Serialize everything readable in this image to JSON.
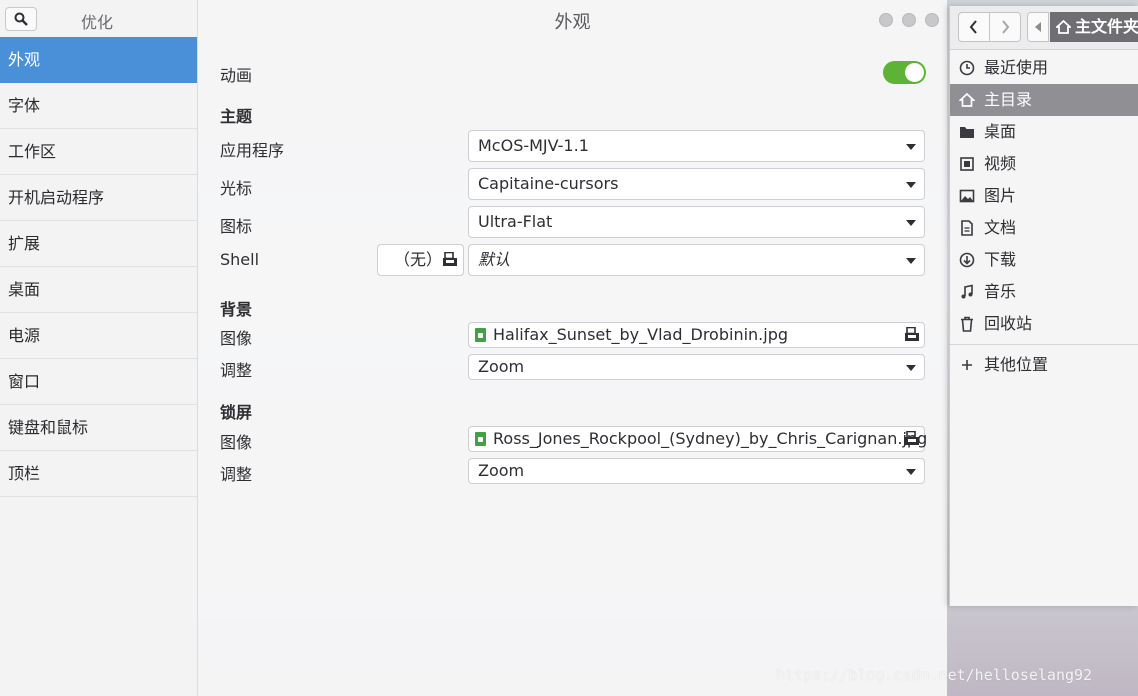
{
  "tweaks": {
    "sidebar": {
      "title": "优化",
      "items": [
        {
          "label": "外观",
          "active": true
        },
        {
          "label": "字体"
        },
        {
          "label": "工作区"
        },
        {
          "label": "开机启动程序"
        },
        {
          "label": "扩展"
        },
        {
          "label": "桌面"
        },
        {
          "label": "电源"
        },
        {
          "label": "窗口"
        },
        {
          "label": "键盘和鼠标"
        },
        {
          "label": "顶栏"
        }
      ]
    },
    "title": "外观",
    "animation": {
      "label": "动画",
      "enabled": true
    },
    "theme": {
      "heading": "主题",
      "app_label": "应用程序",
      "app_value": "McOS-MJV-1.1",
      "cursor_label": "光标",
      "cursor_value": "Capitaine-cursors",
      "icon_label": "图标",
      "icon_value": "Ultra-Flat",
      "shell_label": "Shell",
      "shell_none": "（无）",
      "shell_value": "默认"
    },
    "background": {
      "heading": "背景",
      "image_label": "图像",
      "image_value": "Halifax_Sunset_by_Vlad_Drobinin.jpg",
      "adjust_label": "调整",
      "adjust_value": "Zoom"
    },
    "lockscreen": {
      "heading": "锁屏",
      "image_label": "图像",
      "image_value": "Ross_Jones_Rockpool_(Sydney)_by_Chris_Carignan.jpg",
      "adjust_label": "调整",
      "adjust_value": "Zoom"
    }
  },
  "files": {
    "path_home": "主文件夹",
    "places": [
      {
        "label": "最近使用",
        "icon": "clock-icon"
      },
      {
        "label": "主目录",
        "icon": "home-icon",
        "active": true
      },
      {
        "label": "桌面",
        "icon": "folder-icon"
      },
      {
        "label": "视频",
        "icon": "film-icon"
      },
      {
        "label": "图片",
        "icon": "image-icon"
      },
      {
        "label": "文档",
        "icon": "document-icon"
      },
      {
        "label": "下载",
        "icon": "download-icon"
      },
      {
        "label": "音乐",
        "icon": "music-icon"
      },
      {
        "label": "回收站",
        "icon": "trash-icon"
      }
    ],
    "other_locations": "其他位置"
  },
  "watermark": "https://blog.csdn.net/helloselang92",
  "colors": {
    "accent": "#4a90d9",
    "toggle_on": "#5db336",
    "file_icon": "#43a047"
  }
}
